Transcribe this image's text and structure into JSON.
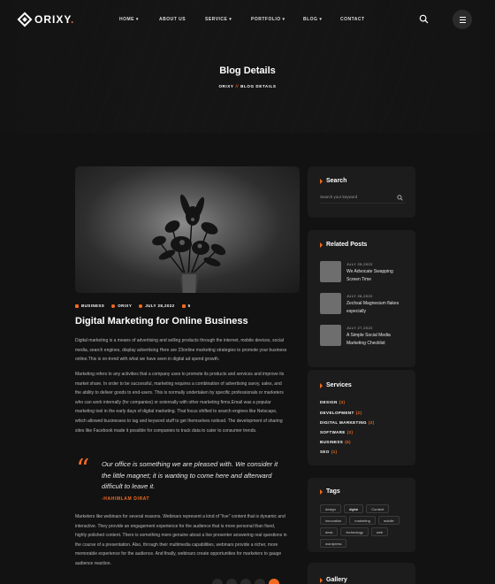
{
  "nav": {
    "logo": "ORIXY",
    "logo_dot": ".",
    "items": [
      {
        "label": "HOME",
        "chevron": true
      },
      {
        "label": "ABOUT US",
        "chevron": false
      },
      {
        "label": "SERVICE",
        "chevron": true
      },
      {
        "label": "PORTFOLIO",
        "chevron": true
      },
      {
        "label": "BLOG",
        "chevron": true
      },
      {
        "label": "CONTACT",
        "chevron": false
      }
    ]
  },
  "hero": {
    "title": "Blog Details",
    "crumb_home": "ORIXY",
    "crumb_sep": "//",
    "crumb_current": "BLOG DETAILS"
  },
  "post": {
    "meta_category": "BUSINESS",
    "meta_author": "ORIXY",
    "meta_date": "JULY 28,2022",
    "meta_comments": "5",
    "title": "Digital Marketing for Online Business",
    "para1": "Digital marketing is a means of advertising and selling products through the internet, mobile devices, social media, search engines, display advertising Here are 23online marketing strategies to promote your business online.This is on-trend with what we have seen in digital ad spend growth.",
    "para2": "Marketing refers to any activities that a company uses to promote its products and services and improve its market share. In order to be successful, marketing requires a combination of advertising savvy, sales, and the ability to deliver goods to end-users. This is normally undertaken by specific professionals or marketers who can work internally (for companies) or externally with other marketing firms.Email was a popular marketing tool in the early days of digital marketing. That focus shifted to search engines like Netscape, which allowed businesses to tag and keyword stuff to get themselves noticed. The development of sharing sites like Facebook made it possible for companies to track data to cater to consumer trends.",
    "quote": "Our office is something we are pleased with. We consider it the little magnet; it is wanting to come here and afterward difficult to leave it.",
    "quote_author": "-HAHIMLAM DIRAT",
    "para3": "Marketers like webinars for several reasons. Webinars represent a kind of \"live\" content that is dynamic and interactive. They provide an engagement experience for the audience that is more personal than fixed, highly polished content. There is something more genuine about a live presenter answering real questions in the course of a presentation. Also, through their multimedia capabilities, webinars provide a richer, more memorable experience for the audience. And finally, webinars create opportunities for marketers to gauge audience reaction."
  },
  "sidebar": {
    "search_title": "Search",
    "search_placeholder": "Search your keyword",
    "related_title": "Related Posts",
    "related": [
      {
        "date": "JULY 25,2022",
        "title": "We Advocate Swapping Screen Time"
      },
      {
        "date": "JULY 26,2022",
        "title": "Zechsal Magnesium flakes especially"
      },
      {
        "date": "JULY 27,2022",
        "title": "A Simple Social Media Marketing Checklist"
      }
    ],
    "services_title": "Services",
    "services": [
      {
        "name": "DESIGN",
        "count": "(3)"
      },
      {
        "name": "DEVELOPMENT",
        "count": "(2)"
      },
      {
        "name": "DIGITAL MARKETING",
        "count": "(2)"
      },
      {
        "name": "SOFTWARE",
        "count": "(2)"
      },
      {
        "name": "BUSINESS",
        "count": "(5)"
      },
      {
        "name": "SEO",
        "count": "(1)"
      }
    ],
    "tags_title": "Tags",
    "tags": [
      "design",
      "digital",
      "Content",
      "innovation",
      "marketing",
      "mobile",
      "desk",
      "technology",
      "web",
      "wordpress"
    ],
    "gallery_title": "Gallery"
  },
  "colors": {
    "accent": "#f26b21",
    "background": "#121212",
    "card": "#1c1c1c"
  }
}
